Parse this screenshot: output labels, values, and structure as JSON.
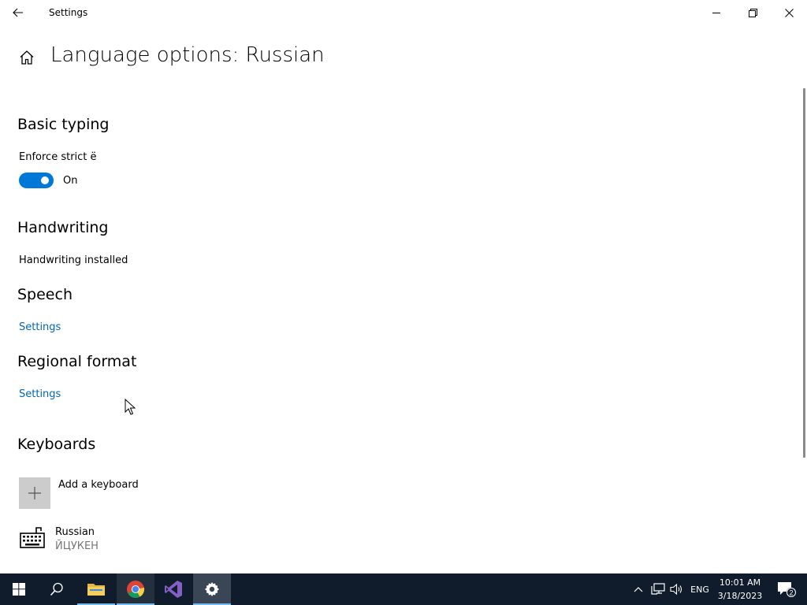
{
  "window": {
    "title": "Settings"
  },
  "header": {
    "title": "Language options: Russian"
  },
  "basic_typing": {
    "heading": "Basic typing",
    "setting_label": "Enforce strict ё",
    "toggle_state": "On",
    "toggle_on": true
  },
  "handwriting": {
    "heading": "Handwriting",
    "status": "Handwriting installed"
  },
  "speech": {
    "heading": "Speech",
    "link": "Settings"
  },
  "regional_format": {
    "heading": "Regional format",
    "link": "Settings"
  },
  "keyboards": {
    "heading": "Keyboards",
    "add_label": "Add a keyboard",
    "items": [
      {
        "name": "Russian",
        "layout": "ЙЦУКЕН"
      }
    ]
  },
  "taskbar": {
    "language": "ENG",
    "time": "10:01 AM",
    "date": "3/18/2023",
    "notification_count": "2"
  },
  "colors": {
    "accent": "#0078d7",
    "link": "#0067b8",
    "taskbar": "#101c2c"
  },
  "icons": {
    "back": "back-arrow-icon",
    "home": "home-icon",
    "add": "plus-icon",
    "keyboard": "keyboard-icon"
  }
}
